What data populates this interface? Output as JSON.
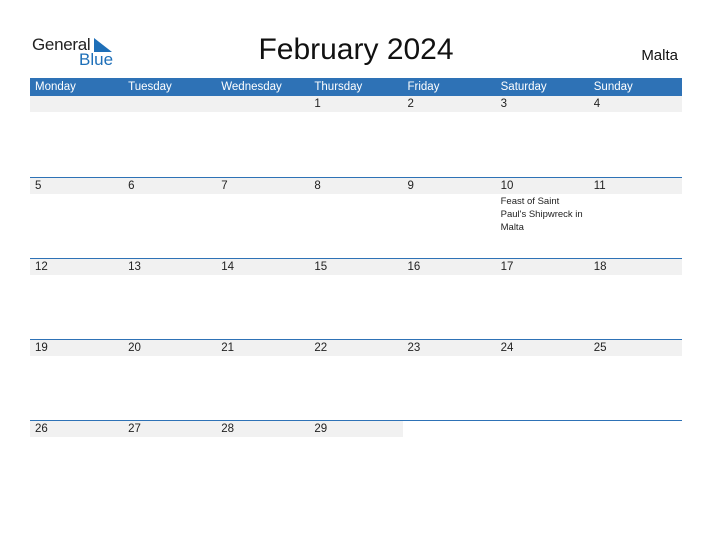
{
  "logo": {
    "line1": "General",
    "line2": "Blue"
  },
  "title": "February 2024",
  "country": "Malta",
  "colors": {
    "accent": "#2e72b6",
    "date_strip": "#f1f1f1",
    "logo_blue": "#1e6fb8"
  },
  "weekdays": [
    "Monday",
    "Tuesday",
    "Wednesday",
    "Thursday",
    "Friday",
    "Saturday",
    "Sunday"
  ],
  "weeks": [
    [
      {
        "day": ""
      },
      {
        "day": ""
      },
      {
        "day": ""
      },
      {
        "day": "1"
      },
      {
        "day": "2"
      },
      {
        "day": "3"
      },
      {
        "day": "4"
      }
    ],
    [
      {
        "day": "5"
      },
      {
        "day": "6"
      },
      {
        "day": "7"
      },
      {
        "day": "8"
      },
      {
        "day": "9"
      },
      {
        "day": "10",
        "event": "Feast of Saint Paul's Shipwreck in Malta"
      },
      {
        "day": "11"
      }
    ],
    [
      {
        "day": "12"
      },
      {
        "day": "13"
      },
      {
        "day": "14"
      },
      {
        "day": "15"
      },
      {
        "day": "16"
      },
      {
        "day": "17"
      },
      {
        "day": "18"
      }
    ],
    [
      {
        "day": "19"
      },
      {
        "day": "20"
      },
      {
        "day": "21"
      },
      {
        "day": "22"
      },
      {
        "day": "23"
      },
      {
        "day": "24"
      },
      {
        "day": "25"
      }
    ],
    [
      {
        "day": "26"
      },
      {
        "day": "27"
      },
      {
        "day": "28"
      },
      {
        "day": "29"
      },
      {
        "day": ""
      },
      {
        "day": ""
      },
      {
        "day": ""
      }
    ]
  ]
}
